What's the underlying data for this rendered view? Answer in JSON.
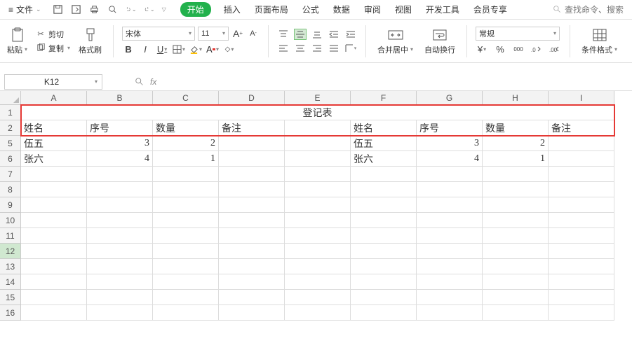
{
  "menubar": {
    "file": "文件",
    "tabs": [
      "开始",
      "插入",
      "页面布局",
      "公式",
      "数据",
      "审阅",
      "视图",
      "开发工具",
      "会员专享"
    ],
    "active_tab": "开始",
    "search_placeholder": "查找命令、搜索"
  },
  "ribbon": {
    "paste": "粘贴",
    "cut": "剪切",
    "copy": "复制",
    "format_painter": "格式刷",
    "font_name": "宋体",
    "font_size": "11",
    "merge_center": "合并居中",
    "wrap_text": "自动换行",
    "number_format": "常规",
    "cond_format": "条件格式"
  },
  "namebox": {
    "value": "K12"
  },
  "sheet": {
    "columns": [
      "A",
      "B",
      "C",
      "D",
      "E",
      "F",
      "G",
      "H",
      "I"
    ],
    "visible_row_labels": [
      "1",
      "2",
      "5",
      "6",
      "7",
      "8",
      "9",
      "10",
      "11",
      "12",
      "13",
      "14",
      "15",
      "16"
    ],
    "row1": {
      "title": "登记表"
    },
    "row2": {
      "A": "姓名",
      "B": "序号",
      "C": "数量",
      "D": "备注",
      "F": "姓名",
      "G": "序号",
      "H": "数量",
      "I": "备注"
    },
    "row5": {
      "A": "伍五",
      "B": "3",
      "C": "2",
      "F": "伍五",
      "G": "3",
      "H": "2"
    },
    "row6": {
      "A": "张六",
      "B": "4",
      "C": "1",
      "F": "张六",
      "G": "4",
      "H": "1"
    },
    "active_cell_row_label": "12"
  }
}
